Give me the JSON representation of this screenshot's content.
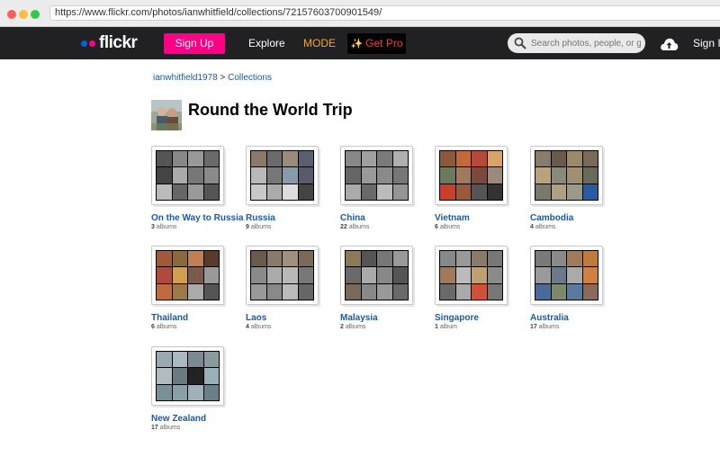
{
  "browser": {
    "url": "https://www.flickr.com/photos/ianwhitfield/collections/72157603700901549/"
  },
  "nav": {
    "logo": "flickr",
    "signup": "Sign Up",
    "explore": "Explore",
    "mode": "MODE",
    "getpro": "Get Pro",
    "search_placeholder": "Search photos, people, or groups",
    "signin": "Sign In"
  },
  "breadcrumb": {
    "user": "ianwhitfield1978",
    "sep": " > ",
    "section": "Collections"
  },
  "page_title": "Round the World Trip",
  "collections": [
    {
      "name": "On the Way to Russia",
      "count": "3",
      "unit": "albums",
      "palette": [
        "#555",
        "#888",
        "#999",
        "#6a6a6a",
        "#444",
        "#aaa",
        "#777",
        "#8a8a8a",
        "#bbb",
        "#666",
        "#999",
        "#555"
      ]
    },
    {
      "name": "Russia",
      "count": "9",
      "unit": "albums",
      "palette": [
        "#8a7a6a",
        "#6b6b6b",
        "#9a8c7a",
        "#5a6070",
        "#b8b8b8",
        "#777",
        "#8899aa",
        "#5a5a6a",
        "#c8c8c8",
        "#aaa",
        "#ddd",
        "#444"
      ]
    },
    {
      "name": "China",
      "count": "22",
      "unit": "albums",
      "palette": [
        "#888",
        "#a0a0a0",
        "#7a7a7a",
        "#b0b0b0",
        "#666",
        "#999",
        "#8a8a8a",
        "#777",
        "#aaa",
        "#6a6a6a",
        "#bbb",
        "#959595"
      ]
    },
    {
      "name": "Vietnam",
      "count": "6",
      "unit": "albums",
      "palette": [
        "#8b5a3a",
        "#c46a3a",
        "#b54a3a",
        "#d8a46a",
        "#6a7a5a",
        "#a07a5a",
        "#7a4a3a",
        "#9a8a7a",
        "#c8402a",
        "#9a5a3a",
        "#555",
        "#333"
      ]
    },
    {
      "name": "Cambodia",
      "count": "4",
      "unit": "albums",
      "palette": [
        "#8a7a6a",
        "#6a5a4a",
        "#9a8a6a",
        "#7a6a5a",
        "#b8a47a",
        "#8a8a7a",
        "#a09070",
        "#6a6a5a",
        "#7a7a6a",
        "#b0a080",
        "#9a9a8a",
        "#2a5aa0"
      ]
    },
    {
      "name": "Thailand",
      "count": "6",
      "unit": "albums",
      "palette": [
        "#a05a3a",
        "#8a6a3a",
        "#c08050",
        "#5a3a2a",
        "#b04a3a",
        "#d0a050",
        "#7a5a4a",
        "#999",
        "#c06a40",
        "#9a7a4a",
        "#aaa",
        "#555"
      ]
    },
    {
      "name": "Laos",
      "count": "4",
      "unit": "albums",
      "palette": [
        "#6a5a4a",
        "#8a7a6a",
        "#a09080",
        "#7a6a5a",
        "#8a8a8a",
        "#aaa",
        "#b8b8b8",
        "#777",
        "#999",
        "#888",
        "#bbb",
        "#666"
      ]
    },
    {
      "name": "Malaysia",
      "count": "2",
      "unit": "albums",
      "palette": [
        "#8a7a5a",
        "#555",
        "#777",
        "#999",
        "#6a6a6a",
        "#aaa",
        "#888",
        "#555",
        "#7a6a5a",
        "#888",
        "#999",
        "#6a6a6a"
      ]
    },
    {
      "name": "Singapore",
      "count": "1",
      "unit": "album",
      "palette": [
        "#888",
        "#999",
        "#8a7a6a",
        "#777",
        "#a07a5a",
        "#bbb",
        "#c0a070",
        "#8a8a8a",
        "#6a6a6a",
        "#aaa",
        "#d0503a",
        "#777"
      ]
    },
    {
      "name": "Australia",
      "count": "17",
      "unit": "albums",
      "palette": [
        "#7a7a7a",
        "#8a8a8a",
        "#a07a5a",
        "#c07a3a",
        "#9a9a9a",
        "#6a7a8a",
        "#aaa",
        "#d08040",
        "#4a6a9a",
        "#7a8a6a",
        "#5a7aa0",
        "#8a6a5a"
      ]
    },
    {
      "name": "New Zealand",
      "count": "17",
      "unit": "albums",
      "palette": [
        "#9aa8b0",
        "#aab8c0",
        "#7a8a90",
        "#8a9aa0",
        "#b0bcc0",
        "#6a7a80",
        "#222",
        "#9ab0b8",
        "#7a9098",
        "#8aa0a8",
        "#a0b0b8",
        "#6a8088"
      ]
    }
  ]
}
